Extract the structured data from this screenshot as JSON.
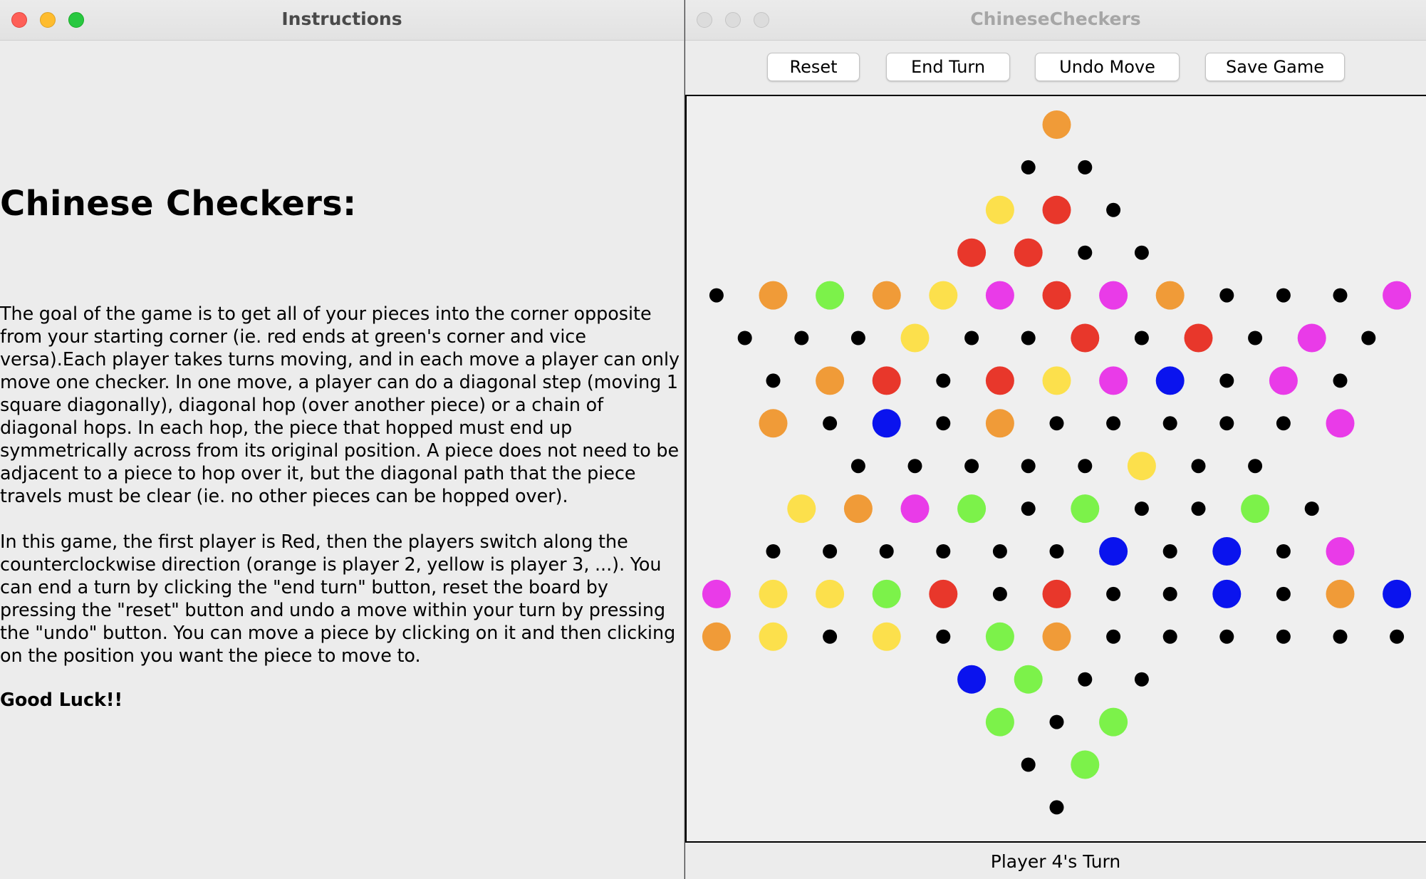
{
  "instructions_window": {
    "title": "Instructions",
    "heading": "Chinese Checkers:",
    "paragraph1": "The goal of the game is to get all of your pieces into the corner opposite from your starting corner (ie. red ends at green's corner and vice versa).Each player takes turns moving, and in each move a player can only move one checker. In one move, a player can do a diagonal step (moving 1 square diagonally), diagonal hop (over another piece) or a chain of diagonal hops. In each hop, the piece that hopped must end up symmetrically across from its original position. A piece does not need to be adjacent to a piece to hop over it, but the diagonal path that the piece travels must be clear (ie. no other pieces can be hopped over).",
    "paragraph2": "In this game, the first player is Red, then the players switch along the counterclockwise direction (orange is player 2, yellow is player 3, ...). You can end a turn by clicking the \"end turn\" button, reset the board by pressing the \"reset\" button and undo a move within your turn by pressing the \"undo\" button. You can move a piece by clicking on it and then clicking on the position you want the piece to move to.",
    "closing": "Good Luck!!"
  },
  "game_window": {
    "title": "ChineseCheckers",
    "buttons": {
      "reset": "Reset",
      "end_turn": "End Turn",
      "undo_move": "Undo Move",
      "save_game": "Save Game"
    },
    "status": "Player 4's Turn"
  },
  "colors": {
    "O": "#f09b38",
    "Y": "#fce04c",
    "R": "#e8372b",
    "G": "#7cf24a",
    "M": "#e93be8",
    "B": "#0a13ee",
    "empty": "#000000"
  },
  "board": {
    "rows": [
      "O",
      "..",
      "YR.",
      "RR..",
      ".OGOYMRMO...M",
      "...Y..R.R.M.",
      ".OR.RYMB.M.",
      "O.B.O.....M",
      ".....Y..",
      "YOMG.G..G.",
      "......B.B.M",
      "MYYGR.R..B.OB",
      "OY.Y.GO......",
      "BG..",
      "G.G",
      ".G",
      "."
    ]
  }
}
